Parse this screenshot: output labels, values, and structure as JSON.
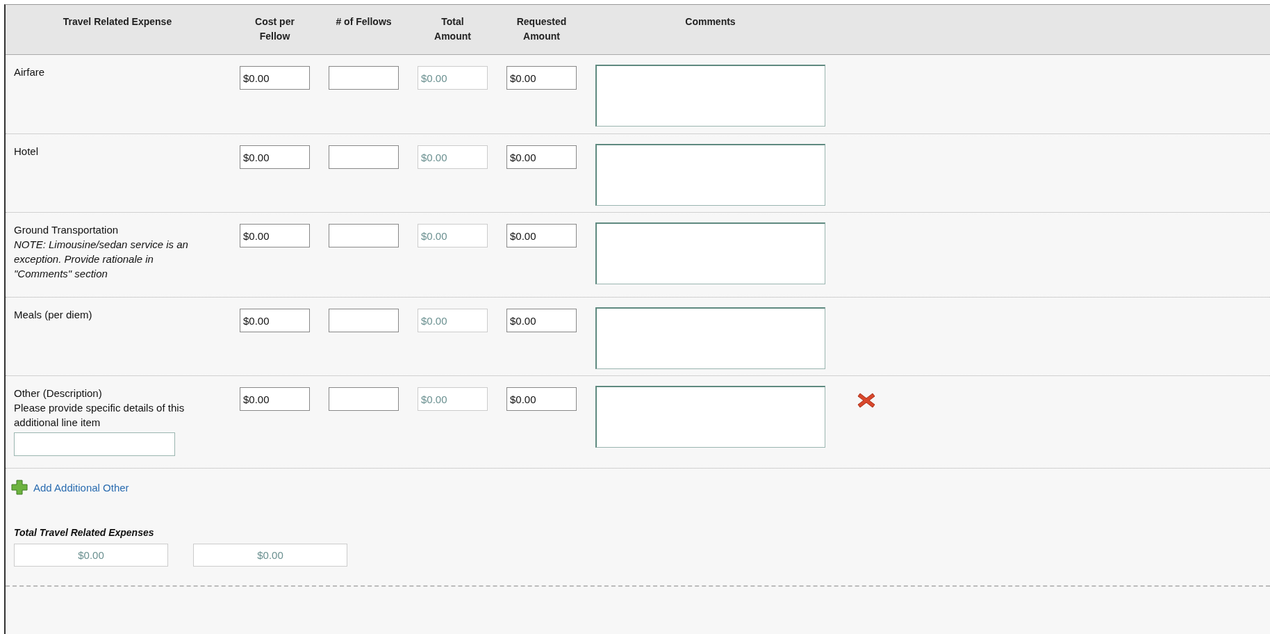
{
  "columns": [
    "Travel Related Expense",
    "Cost per Fellow",
    "# of Fellows",
    "Total Amount",
    "Requested Amount",
    "Comments"
  ],
  "rows": [
    {
      "label": "Airfare",
      "cost": {
        "value": "$0.00",
        "disabled": false
      },
      "fellows": {
        "disabled": false
      },
      "total": {
        "value": "$0.00",
        "disabled": true
      },
      "requested": {
        "value": "$0.00",
        "disabled": false
      },
      "removable": false
    },
    {
      "label": "Hotel",
      "cost": {
        "value": "$0.00",
        "disabled": false
      },
      "fellows": {
        "disabled": false
      },
      "total": {
        "value": "$0.00",
        "disabled": true
      },
      "requested": {
        "value": "$0.00",
        "disabled": false
      },
      "removable": false
    },
    {
      "label": "Ground Transportation",
      "note": "NOTE: Limousine/sedan service is an exception. Provide rationale in \"Comments\" section",
      "cost": {
        "value": "$0.00",
        "disabled": false
      },
      "fellows": {
        "disabled": false
      },
      "total": {
        "value": "$0.00",
        "disabled": true
      },
      "requested": {
        "value": "$0.00",
        "disabled": false
      },
      "removable": false
    },
    {
      "label": "Meals (per diem)",
      "cost": {
        "value": "$0.00",
        "disabled": false
      },
      "fellows": {
        "disabled": false
      },
      "total": {
        "value": "$0.00",
        "disabled": true
      },
      "requested": {
        "value": "$0.00",
        "disabled": false
      },
      "removable": false
    },
    {
      "label": "Other (Description)",
      "hint": "Please provide specific details of this additional line item",
      "description_field": {
        "disabled": false
      },
      "cost": {
        "value": "$0.00",
        "disabled": false
      },
      "fellows": {
        "disabled": false
      },
      "total": {
        "value": "$0.00",
        "disabled": true
      },
      "requested": {
        "value": "$0.00",
        "disabled": false
      },
      "removable": true
    }
  ],
  "add_link": "Add Additional Other",
  "totals": {
    "title": "Total Travel Related Expenses",
    "fields": [
      {
        "value": "$0.00",
        "disabled": true
      },
      {
        "value": "$0.00",
        "disabled": true
      }
    ]
  }
}
